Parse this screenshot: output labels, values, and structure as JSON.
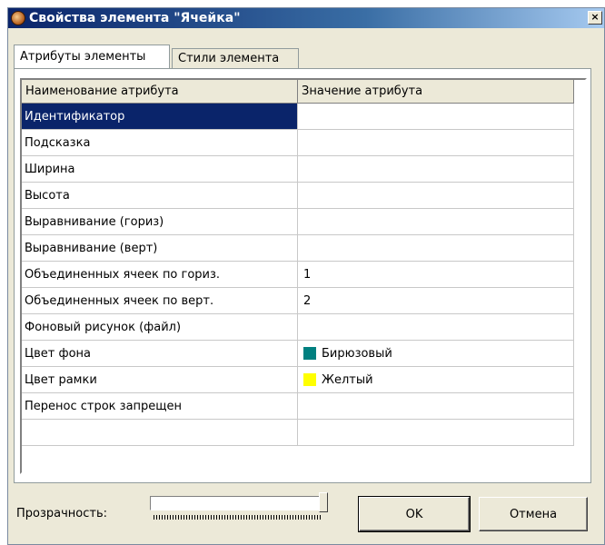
{
  "window": {
    "title": "Свойства элемента \"Ячейка\"",
    "close_glyph": "×",
    "icon": "app-icon"
  },
  "tabs": [
    {
      "label": "Атрибуты элементы",
      "active": true
    },
    {
      "label": "Стили элемента",
      "active": false
    }
  ],
  "grid": {
    "columns": [
      "Наименование атрибута",
      "Значение атрибута"
    ],
    "rows": [
      {
        "name": "Идентификатор",
        "value": ""
      },
      {
        "name": "Подсказка",
        "value": ""
      },
      {
        "name": "Ширина",
        "value": ""
      },
      {
        "name": "Высота",
        "value": ""
      },
      {
        "name": "Выравнивание (гориз)",
        "value": ""
      },
      {
        "name": "Выравнивание (верт)",
        "value": ""
      },
      {
        "name": "Объединенных ячеек по гориз.",
        "value": "1"
      },
      {
        "name": "Объединенных ячеек по верт.",
        "value": "2"
      },
      {
        "name": "Фоновый рисунок (файл)",
        "value": ""
      },
      {
        "name": "Цвет фона",
        "value": "Бирюзовый",
        "color": "#008080"
      },
      {
        "name": "Цвет рамки",
        "value": "Желтый",
        "color": "#ffff00"
      },
      {
        "name": "Перенос строк запрещен",
        "value": ""
      },
      {
        "name": "",
        "value": ""
      }
    ],
    "selected_row": 0
  },
  "bottom": {
    "transparency_label": "Прозрачность:",
    "transparency_value": 1.0,
    "ok_label": "OK",
    "cancel_label": "Отмена"
  }
}
